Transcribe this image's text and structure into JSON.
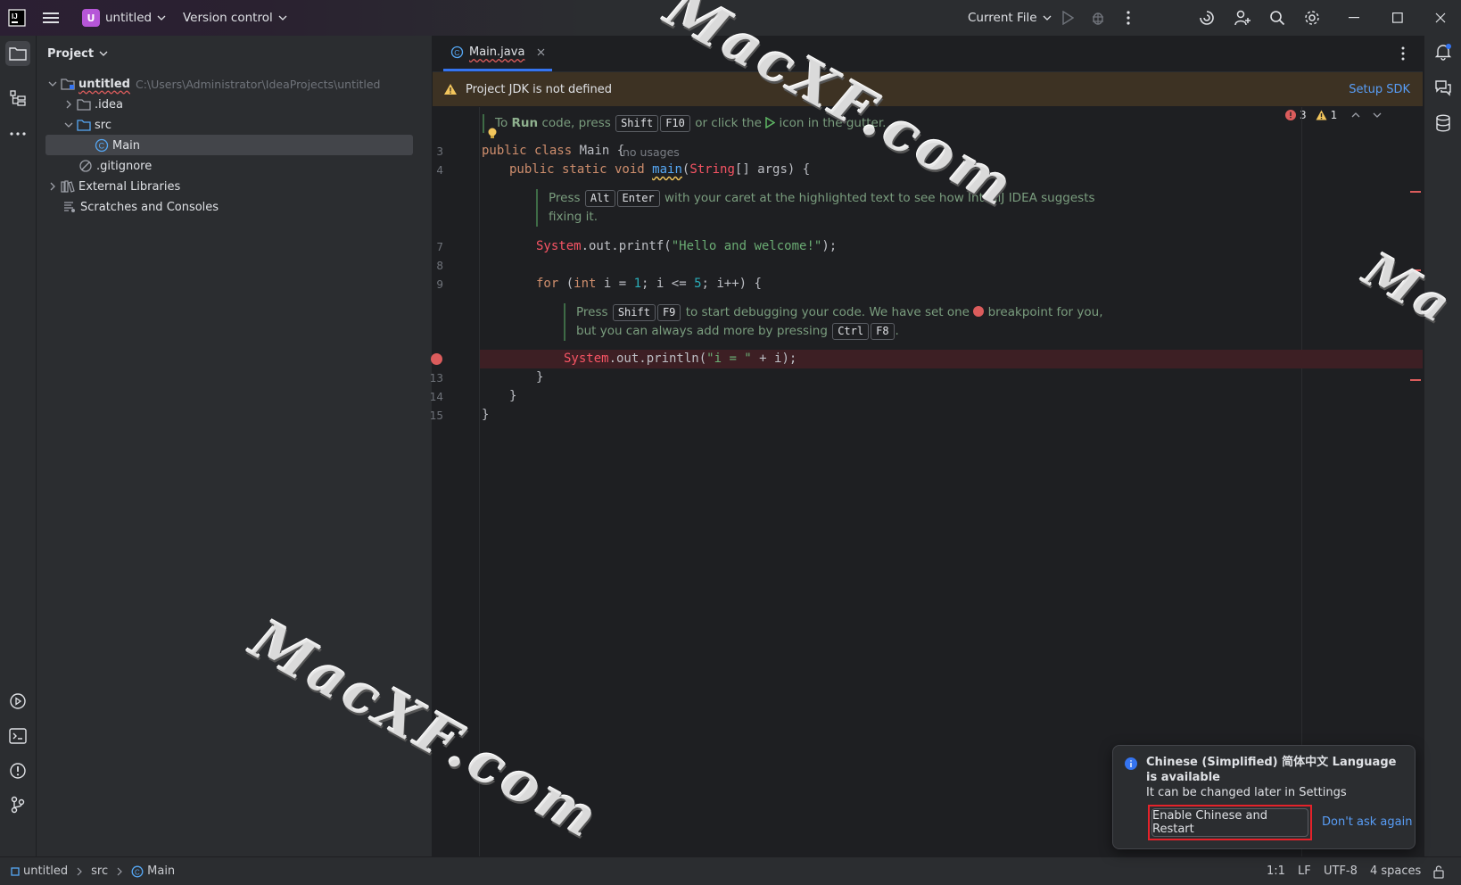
{
  "titlebar": {
    "project_badge": "U",
    "project_name": "untitled",
    "vcs": "Version control",
    "run_config": "Current File"
  },
  "project_panel": {
    "title": "Project",
    "tree": [
      {
        "label": "untitled",
        "path": "C:\\Users\\Administrator\\IdeaProjects\\untitled"
      },
      {
        "label": ".idea"
      },
      {
        "label": "src"
      },
      {
        "label": "Main"
      },
      {
        "label": ".gitignore"
      },
      {
        "label": "External Libraries"
      },
      {
        "label": "Scratches and Consoles"
      }
    ]
  },
  "editor": {
    "tab": "Main.java",
    "jdk_warning": "Project JDK is not defined",
    "setup_sdk": "Setup SDK",
    "errors": "3",
    "warnings": "1",
    "hint_run": {
      "a": "To",
      "run": "Run",
      "b": "code, press",
      "k1": "Shift",
      "k2": "F10",
      "c": "or click the",
      "d": "icon in the gutter."
    },
    "line_numbers": [
      "3",
      "4",
      "7",
      "8",
      "9",
      "13",
      "14",
      "15"
    ],
    "lines": {
      "l3": {
        "kw": "public class",
        "name": "Main",
        "brace": "{",
        "usages": "no usages"
      },
      "l4": {
        "kw": "public static void",
        "fn": "main",
        "p1": "(",
        "type": "String",
        "p2": "[] args) {"
      },
      "l7": {
        "sys": "System",
        "rest": ".out.printf(",
        "str": "\"Hello and welcome!\"",
        "end": ");"
      },
      "l9": {
        "kw": "for",
        "a": " (",
        "kw2": "int",
        "b": " i = ",
        "n1": "1",
        "c": "; i <= ",
        "n2": "5",
        "d": "; i++) {"
      },
      "l12": {
        "sys": "System",
        "rest": ".out.println(",
        "str": "\"i = \"",
        "end": " + i);"
      },
      "l13": "}",
      "l14": "}",
      "l15": "}"
    },
    "hint_alt": {
      "a": "Press",
      "k1": "Alt",
      "k2": "Enter",
      "b": "with your caret at the highlighted text to see how IntelliJ IDEA suggests",
      "c": "fixing it."
    },
    "hint_debug": {
      "a": "Press",
      "k1": "Shift",
      "k2": "F9",
      "b": "to start debugging your code. We have set one",
      "c": "breakpoint for you,",
      "d": "but you can always add more by pressing",
      "k3": "Ctrl",
      "k4": "F8",
      "e": "."
    }
  },
  "notification": {
    "title": "Chinese (Simplified) 简体中文 Language is available",
    "body": "It can be changed later in Settings",
    "primary": "Enable Chinese and Restart",
    "secondary": "Don't ask again"
  },
  "statusbar": {
    "crumbs": [
      "untitled",
      "src",
      "Main"
    ],
    "position": "1:1",
    "line_sep": "LF",
    "encoding": "UTF-8",
    "indent": "4 spaces"
  },
  "watermark": {
    "text": "MacXF.com",
    "text_partial": "Ma"
  },
  "colors": {
    "accent": "#3574f0",
    "error": "#db5c5c",
    "warning": "#f2c55c",
    "highlight_red": "#e5222a"
  }
}
